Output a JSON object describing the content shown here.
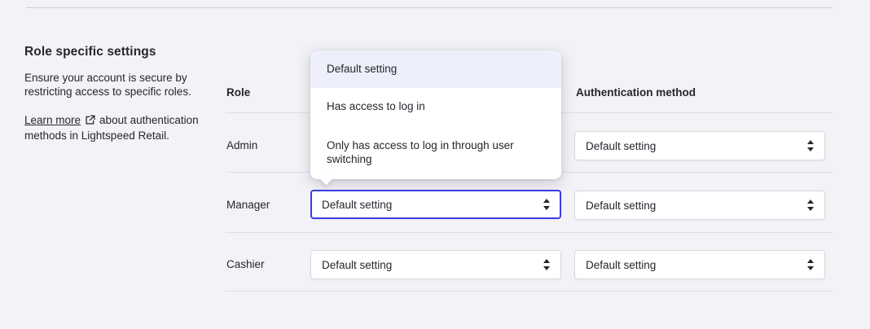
{
  "window": {
    "background": "#f3f2f6"
  },
  "colors": {
    "focus_border": "#3c3ce8",
    "option_highlight": "#edeffa",
    "text": "#26262e",
    "divider": "#dedde3",
    "select_border": "#d9d8de"
  },
  "section": {
    "title": "Role specific settings",
    "description": "Ensure your account is secure by restricting access to specific roles.",
    "learn_more": {
      "link": "Learn more",
      "suffix": "about authentication methods in Lightspeed Retail."
    }
  },
  "table": {
    "role_header": "Role",
    "auth_header": "Authentication method",
    "rows": [
      {
        "role": "Admin",
        "auth": "Default setting"
      },
      {
        "role": "Manager",
        "login": "Default setting",
        "auth": "Default setting"
      },
      {
        "role": "Cashier",
        "login": "Default setting",
        "auth": "Default setting"
      }
    ]
  },
  "dropdown": {
    "highlighted_index": 0,
    "options": [
      "Default setting",
      "Has access to log in",
      "Only has access to log in through user switching"
    ]
  }
}
